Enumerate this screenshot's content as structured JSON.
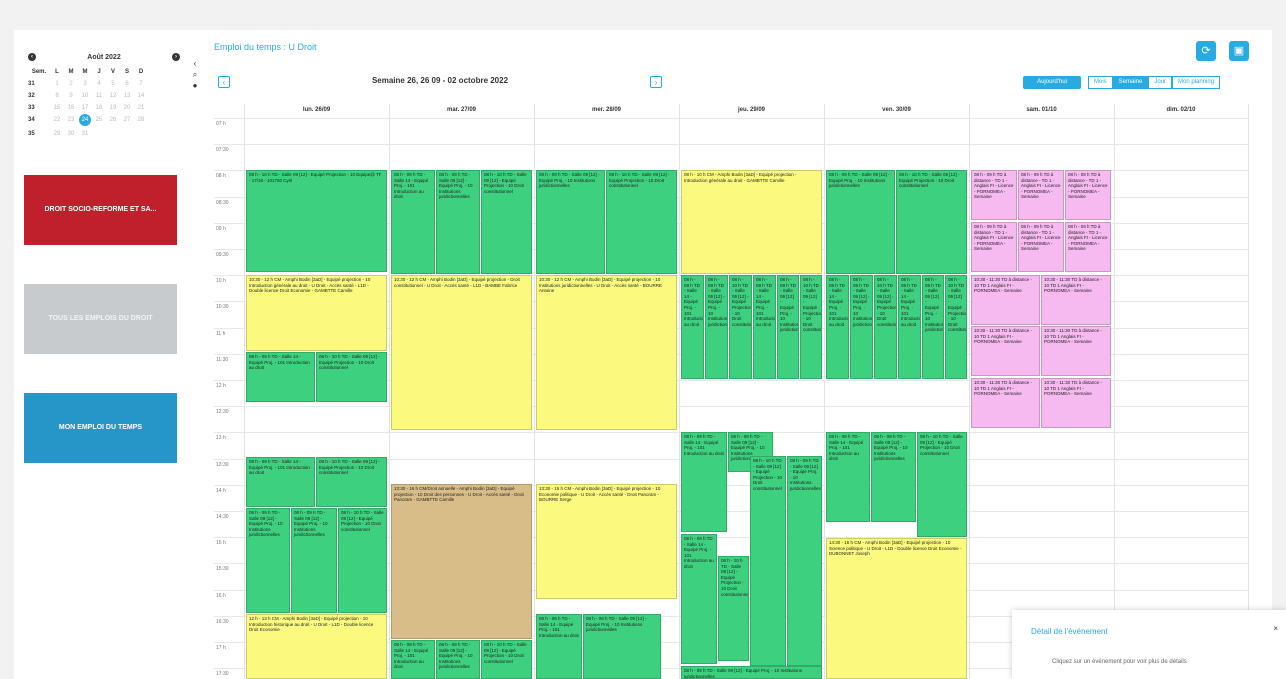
{
  "mini_calendar": {
    "month_label": "Août 2022",
    "weekday_headers": [
      "Sem.",
      "L",
      "M",
      "M",
      "J",
      "V",
      "S",
      "D"
    ],
    "rows": [
      {
        "week": "31",
        "days": [
          "1",
          "2",
          "3",
          "4",
          "5",
          "6",
          "7"
        ]
      },
      {
        "week": "32",
        "days": [
          "8",
          "9",
          "10",
          "11",
          "12",
          "13",
          "14"
        ]
      },
      {
        "week": "33",
        "days": [
          "15",
          "16",
          "17",
          "18",
          "19",
          "20",
          "21"
        ]
      },
      {
        "week": "34",
        "days": [
          "22",
          "23",
          "24",
          "25",
          "26",
          "27",
          "28"
        ]
      },
      {
        "week": "35",
        "days": [
          "29",
          "30",
          "31",
          "",
          "",
          "",
          ""
        ]
      }
    ],
    "today": "24"
  },
  "tiles": {
    "red": "DROIT SOCIO-REFORME ET SA...",
    "grey": "TOUS LES EMPLOIS DU DROIT",
    "blue": "MON EMPLOI DU TEMPS"
  },
  "header": {
    "title": "Emploi du temps : U Droit",
    "refresh_icon": "refresh-icon",
    "print_icon": "print-icon",
    "range_label": "Semaine 26, 26 09 - 02 octobre 2022",
    "prev_label": "‹",
    "next_label": "›",
    "today_label": "Aujourd'hui",
    "views": [
      "Mois",
      "Semaine",
      "Jour",
      "Mon planning"
    ],
    "active_view": "Semaine"
  },
  "calendar": {
    "days": [
      "lun. 26/09",
      "mar. 27/09",
      "mer. 28/09",
      "jeu. 29/09",
      "ven. 30/09",
      "sam. 01/10",
      "dim. 02/10"
    ],
    "times": [
      "07 h",
      "07:30",
      "08 h",
      "08:30",
      "09 h",
      "09:30",
      "10 h",
      "10:30",
      "11 h",
      "11:30",
      "12 h",
      "12:30",
      "13 h",
      "13:30",
      "14 h",
      "14:30",
      "15 h",
      "15:30",
      "16 h",
      "16:30",
      "17 h",
      "17:30"
    ],
    "event_colors": {
      "green": "#3dd07f",
      "yellow": "#fbfa7e",
      "pink": "#f6b9f0",
      "tan": "#d8bd88"
    }
  },
  "events": {
    "e1": "08 h - 10 h\nTD - Salle 09 [12] - Equipé Projection - 10 Equipe@ TF - 17/18 - 101750 Cyril",
    "e2": "10:30 - 12 h\nCM - Amphi Bodin [3aD] - Equipé projection - 10 Introduction générale au droit - U Droit - Accès santé - L1D - Double licence Droit Economie - GAMBTTE Camille",
    "e3": "08 h - 09 h\nTD - Salle 14 - Equipé Proj. - 101 Introduction au droit",
    "e4": "08 h - 10 h\nCM - Amphi Bodin [3aD] - Equipé projection - Introduction générale au droit - GAMBTTE Camille",
    "e5": "10:30 - 12 h\nCM - Amphi Bodin [3aD] - Equipé projection - Droit constitutionnel - U Droit - Accès santé - L1D - BAMBE Fabrice",
    "e6": "13:30 - 16 h\nCM/Droit annuelle - Amphi Bodin [3aD] - Equipé projection - 10 Droit des personnes - U Droit - Accès santé - Droit Panoram - GAMBTTE Camille",
    "e7": "08 h - 09 h\nTD - Salle 09 [12] - Equipé Proj. - 10 Institutions juridictionnelles",
    "e8": "10:30 - 12 h\nCM - Amphi Bodin [3aD] - Equipé projection - 10 Institutions juridictionnelles - U Droit - Accès santé - BOURRE Antoine",
    "e9": "13:30 - 15 h\nCM - Amphi Bodin [3aD] - Equipé projection - 10 Economie politique - U Droit - Accès santé - Droit Panoram - BOURRE Serge",
    "e10": "08 h - 10 h\nCM - Amphi Bodin [3aD] - Equipé projection - 10 Introduction générale au droit - U Droit - L1D - Double licence Droit Economie - GAMBTTE Camille",
    "e11": "08 h - 10 h\nTD - Salle 09 [12] - Equipé Projection - 10 Droit constitutionnel",
    "e12": "14:30 - 16 h\nCM - Amphi Bodin [3aD] - Equipé projection - 10 Science politique - U Droit - L1D - Double licence Droit Economie - DUBONNET Joseph",
    "e13": "08 h - 09 h\nTD à distance - TD 1 - Anglais FI - Licence - PORNOMEA - Semaine",
    "e14": "10:30 - 11:30\nTD à distance - 10 TD 1 Anglais FI - PORNOMEA - Semaine",
    "e15": "12 h - 13 h\nCM - Amphi Bodin [3aD] - Equipé projection - 10 Introduction historique au droit - U Droit - L1D - Double licence Droit Economie"
  },
  "detail": {
    "title": "Détail de l'événement",
    "close": "×",
    "hint": "Cliquez sur un événement pour voir plus de détails"
  }
}
